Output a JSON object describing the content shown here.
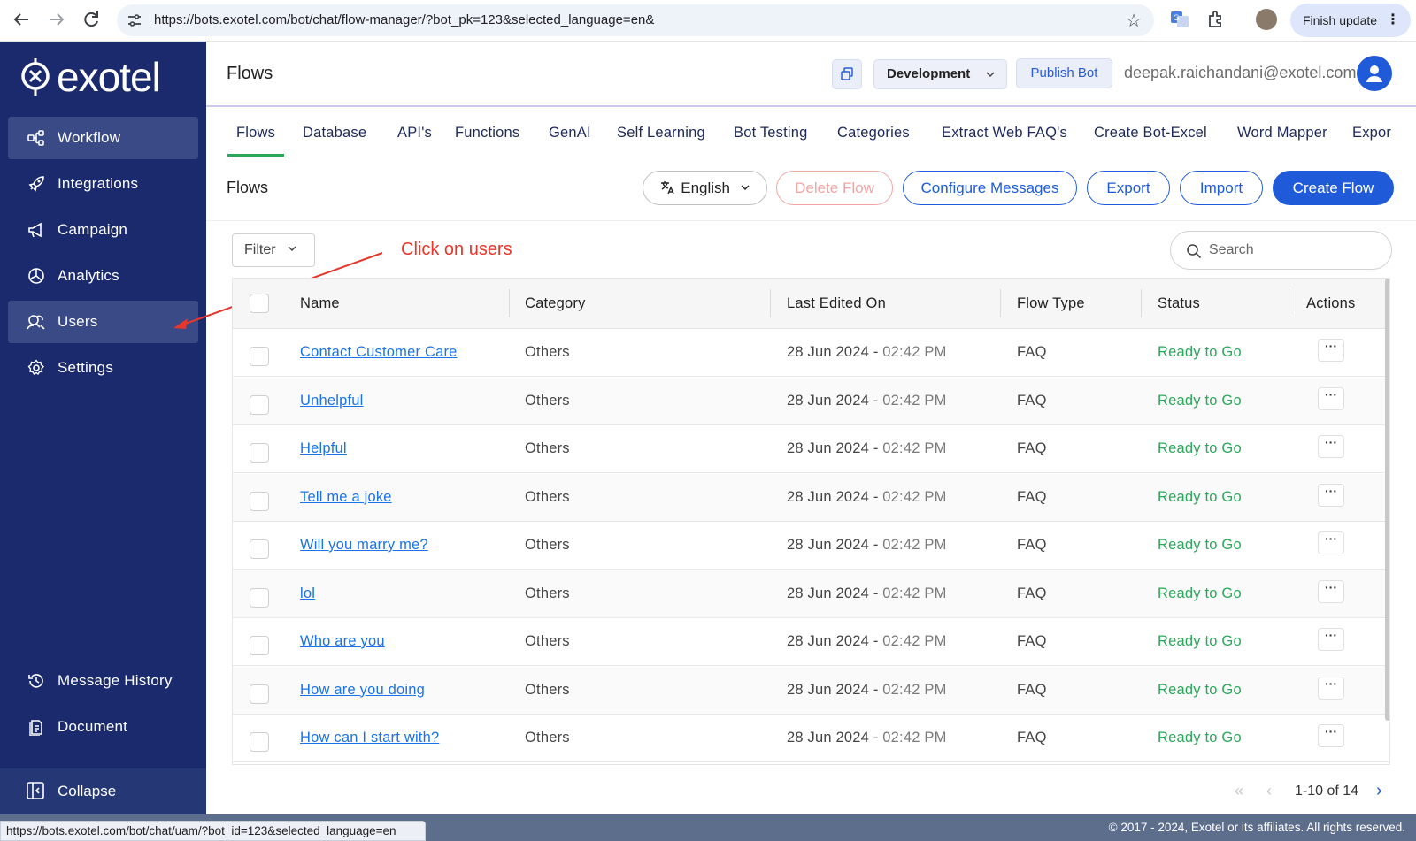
{
  "browser": {
    "url": "https://bots.exotel.com/bot/chat/flow-manager/?bot_pk=123&selected_language=en&",
    "finish_update": "Finish update",
    "status_url": "https://bots.exotel.com/bot/chat/uam/?bot_id=123&selected_language=en"
  },
  "sidebar": {
    "logo_text": "exotel",
    "items": [
      {
        "label": "Workflow",
        "icon": "workflow-icon"
      },
      {
        "label": "Integrations",
        "icon": "rocket-icon"
      },
      {
        "label": "Campaign",
        "icon": "megaphone-icon"
      },
      {
        "label": "Analytics",
        "icon": "analytics-icon"
      },
      {
        "label": "Users",
        "icon": "users-icon"
      },
      {
        "label": "Settings",
        "icon": "gear-icon"
      }
    ],
    "bottom_items": [
      {
        "label": "Message History",
        "icon": "history-icon"
      },
      {
        "label": "Document",
        "icon": "document-icon"
      }
    ],
    "collapse_label": "Collapse"
  },
  "header": {
    "title": "Flows",
    "environment": "Development",
    "publish_label": "Publish Bot",
    "email": "deepak.raichandani@exotel.com"
  },
  "tabs": [
    "Flows",
    "Database",
    "API's",
    "Functions",
    "GenAI",
    "Self Learning",
    "Bot Testing",
    "Categories",
    "Extract Web FAQ's",
    "Create Bot-Excel",
    "Word Mapper",
    "Expor"
  ],
  "toolbar": {
    "section_title": "Flows",
    "language": "English",
    "delete_label": "Delete Flow",
    "configure_label": "Configure Messages",
    "export_label": "Export",
    "import_label": "Import",
    "create_label": "Create Flow"
  },
  "filter_label": "Filter",
  "search_placeholder": "Search",
  "annotation": "Click on users",
  "table": {
    "columns": [
      "Name",
      "Category",
      "Last Edited On",
      "Flow Type",
      "Status",
      "Actions"
    ],
    "rows": [
      {
        "name": "Contact Customer Care",
        "category": "Others",
        "date": "28 Jun 2024",
        "time": "02:42 PM",
        "type": "FAQ",
        "status": "Ready to Go"
      },
      {
        "name": "Unhelpful",
        "category": "Others",
        "date": "28 Jun 2024",
        "time": "02:42 PM",
        "type": "FAQ",
        "status": "Ready to Go"
      },
      {
        "name": "Helpful",
        "category": "Others",
        "date": "28 Jun 2024",
        "time": "02:42 PM",
        "type": "FAQ",
        "status": "Ready to Go"
      },
      {
        "name": "Tell me a joke",
        "category": "Others",
        "date": "28 Jun 2024",
        "time": "02:42 PM",
        "type": "FAQ",
        "status": "Ready to Go"
      },
      {
        "name": "Will you marry me?",
        "category": "Others",
        "date": "28 Jun 2024",
        "time": "02:42 PM",
        "type": "FAQ",
        "status": "Ready to Go"
      },
      {
        "name": "lol",
        "category": "Others",
        "date": "28 Jun 2024",
        "time": "02:42 PM",
        "type": "FAQ",
        "status": "Ready to Go"
      },
      {
        "name": "Who are you",
        "category": "Others",
        "date": "28 Jun 2024",
        "time": "02:42 PM",
        "type": "FAQ",
        "status": "Ready to Go"
      },
      {
        "name": "How are you doing",
        "category": "Others",
        "date": "28 Jun 2024",
        "time": "02:42 PM",
        "type": "FAQ",
        "status": "Ready to Go"
      },
      {
        "name": "How can I start with?",
        "category": "Others",
        "date": "28 Jun 2024",
        "time": "02:42 PM",
        "type": "FAQ",
        "status": "Ready to Go"
      }
    ]
  },
  "pagination": "1-10 of 14",
  "footer_text": "© 2017 - 2024, Exotel or its affiliates. All rights reserved.",
  "colors": {
    "sidebar_bg": "#1a2a6c",
    "accent_blue": "#1f5bd9",
    "status_green": "#2aa85a",
    "annotation_red": "#e5372b"
  }
}
